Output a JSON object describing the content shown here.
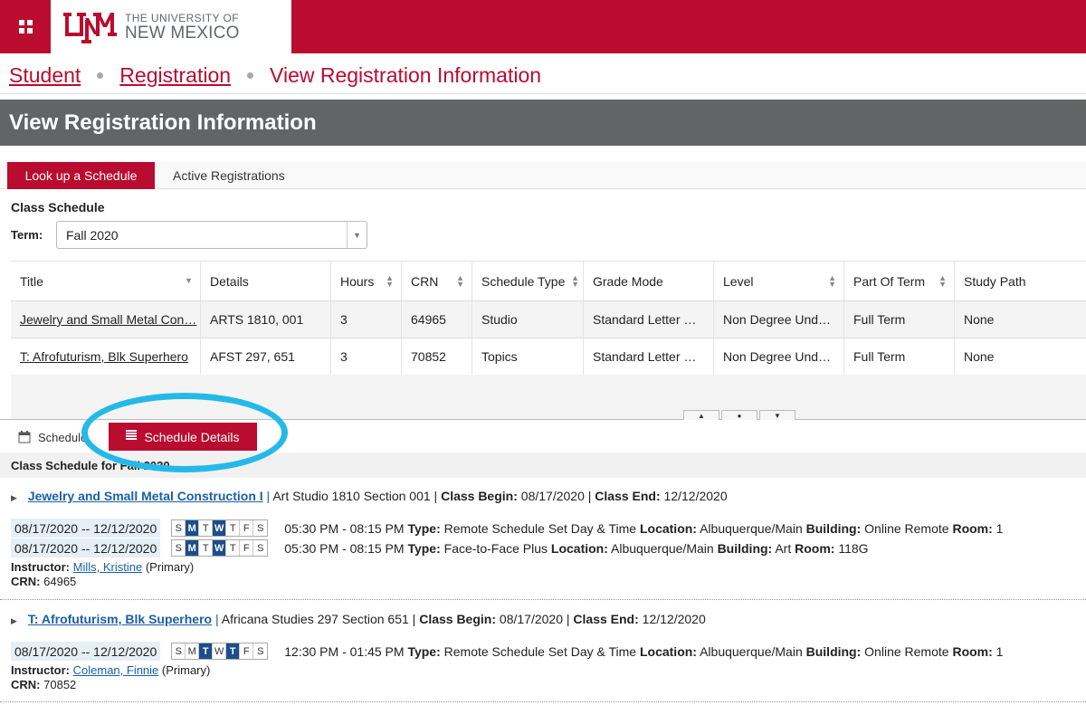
{
  "header": {
    "university_line1": "THE UNIVERSITY OF",
    "university_line2": "NEW MEXICO",
    "brand_color": "#ba0c2f"
  },
  "breadcrumb": [
    "Student",
    "Registration",
    "View Registration Information"
  ],
  "page_title": "View Registration Information",
  "top_tabs": [
    {
      "label": "Look up a Schedule",
      "active": true
    },
    {
      "label": "Active Registrations",
      "active": false
    }
  ],
  "class_schedule_label": "Class Schedule",
  "term": {
    "label": "Term:",
    "value": "Fall 2020"
  },
  "grid": {
    "columns": [
      "Title",
      "Details",
      "Hours",
      "CRN",
      "Schedule Type",
      "Grade Mode",
      "Level",
      "Part Of Term",
      "Study Path"
    ],
    "rows": [
      [
        "Jewelry and Small Metal Con…",
        "ARTS 1810, 001",
        "3",
        "64965",
        "Studio",
        "Standard Letter …",
        "Non Degree Und…",
        "Full Term",
        "None"
      ],
      [
        "T: Afrofuturism, Blk Superhero",
        "AFST 297, 651",
        "3",
        "70852",
        "Topics",
        "Standard Letter …",
        "Non Degree Und…",
        "Full Term",
        "None"
      ]
    ]
  },
  "bottom_tabs": [
    {
      "label": "Schedule",
      "active": false
    },
    {
      "label": "Schedule Details",
      "active": true
    }
  ],
  "schedule_for_label": "Class Schedule for Fall 2020",
  "labels": {
    "type": "Type:",
    "location": "Location:",
    "building": "Building:",
    "room": "Room:",
    "instructor": "Instructor:",
    "crn": "CRN:",
    "class_begin": "Class Begin:",
    "class_end": "Class End:",
    "primary": "(Primary)"
  },
  "days_letters": [
    "S",
    "M",
    "T",
    "W",
    "T",
    "F",
    "S"
  ],
  "courses": [
    {
      "title": "Jewelry and Small Metal Construction I",
      "subject_section": "Art Studio 1810 Section 001",
      "class_begin": "08/17/2020",
      "class_end": "12/12/2020",
      "meetings": [
        {
          "dates": "08/17/2020 -- 12/12/2020",
          "active_days": [
            1,
            3
          ],
          "time": "05:30 PM - 08:15 PM",
          "type": "Remote Schedule Set Day & Time",
          "location": "Albuquerque/Main",
          "building": "Online Remote",
          "room": "1"
        },
        {
          "dates": "08/17/2020 -- 12/12/2020",
          "active_days": [
            1,
            3
          ],
          "time": "05:30 PM - 08:15 PM",
          "type": "Face-to-Face Plus",
          "location": "Albuquerque/Main",
          "building": "Art",
          "room": "118G"
        }
      ],
      "instructor": "Mills, Kristine",
      "crn": "64965"
    },
    {
      "title": "T: Afrofuturism, Blk Superhero",
      "subject_section": "Africana Studies 297 Section 651",
      "class_begin": "08/17/2020",
      "class_end": "12/12/2020",
      "meetings": [
        {
          "dates": "08/17/2020 -- 12/12/2020",
          "active_days": [
            2,
            4
          ],
          "time": "12:30 PM - 01:45 PM",
          "type": "Remote Schedule Set Day & Time",
          "location": "Albuquerque/Main",
          "building": "Online Remote",
          "room": "1"
        }
      ],
      "instructor": "Coleman, Finnie",
      "crn": "70852"
    }
  ]
}
